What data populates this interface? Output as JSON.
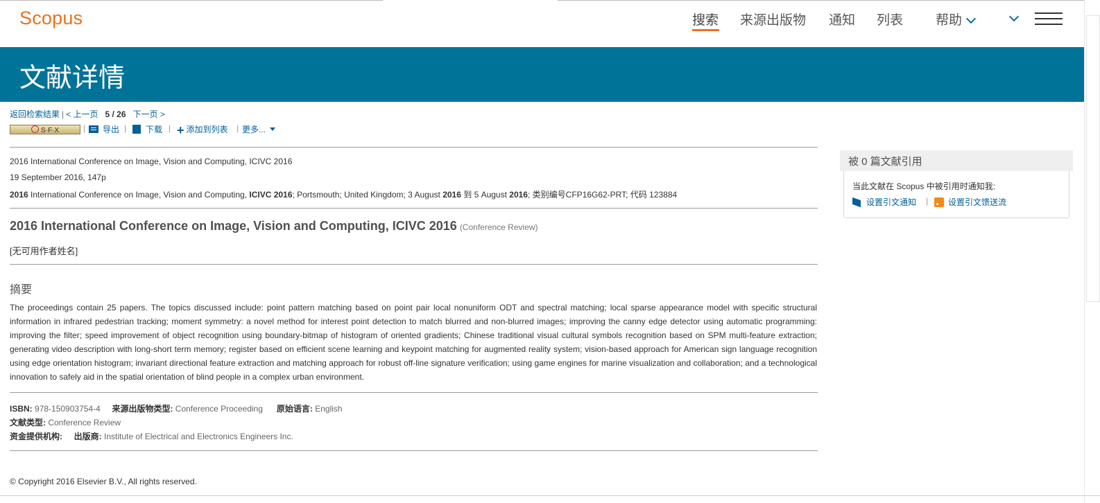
{
  "header": {
    "logo": "Scopus",
    "nav": {
      "search": "搜索",
      "sources": "来源出版物",
      "alerts": "通知",
      "lists": "列表",
      "help": "帮助"
    }
  },
  "banner": {
    "title": "文献详情"
  },
  "pagenav": {
    "back": "返回检索结果",
    "prev": "< 上一页",
    "position": "5 / 26",
    "next": "下一页 >"
  },
  "toolbar": {
    "sfx": "S·F·X",
    "export": "导出",
    "download": "下载",
    "add_to_list": "添加到列表",
    "more": "更多..."
  },
  "source": {
    "name": "2016 International Conference on Image, Vision and Computing, ICIVC 2016",
    "date_pages": "19 September 2016, 147p",
    "conf_year": "2016",
    "conf_name": " International Conference on Image, Vision and Computing, ",
    "conf_acronym": "ICIVC 2016",
    "conf_location": "; Portsmouth; United Kingdom; 3 August ",
    "conf_start_year": "2016",
    "conf_to": " 到 5 August ",
    "conf_end_year": "2016",
    "conf_codes": "; 类别编号CFP16G62-PRT; 代码 123884"
  },
  "document": {
    "title": "2016 International Conference on Image, Vision and Computing, ICIVC 2016",
    "type": "(Conference Review)",
    "authors": "[无可用作者姓名]"
  },
  "abstract": {
    "heading": "摘要",
    "text": "The proceedings contain 25 papers. The topics discussed include: point pattern matching based on point pair local nonuniform ODT and spectral matching; local sparse appearance model with specific structural information in infrared pedestrian tracking; moment symmetry: a novel method for interest point detection to match blurred and non-blurred images; improving the canny edge detector using automatic programming: improving the filter; speed improvement of object recognition using boundary-bitmap of histogram of oriented gradients; Chinese traditional visual cultural symbols recognition based on SPM multi-feature extraction; generating video description with long-short term memory; register based on efficient scene learning and keypoint matching for augmented reality system; vision-based approach for American sign language recognition using edge orientation histogram; invariant directional feature extraction and matching approach for robust off-line signature verification; using game engines for marine visualization and collaboration; and a technological innovation to safely aid in the spatial orientation of blind people in a complex urban environment."
  },
  "metadata": {
    "isbn_label": "ISBN:",
    "isbn": "978-150903754-4",
    "source_type_label": "来源出版物类型:",
    "source_type": "Conference Proceeding",
    "language_label": "原始语言:",
    "language": "English",
    "doc_type_label": "文献类型:",
    "doc_type": "Conference Review",
    "funding_label": "资金提供机构:",
    "publisher_label": "出版商:",
    "publisher": "Institute of Electrical and Electronics Engineers Inc."
  },
  "footer": {
    "copyright": "© Copyright 2016 Elsevier B.V., All rights reserved."
  },
  "sidebar": {
    "cited_by": "被 0 篇文献引用",
    "notify_text": "当此文献在 Scopus 中被引用时通知我:",
    "set_alert": "设置引文通知",
    "set_feed": "设置引文馈送流"
  },
  "colors": {
    "brand": "#e9711c",
    "banner": "#007398",
    "link": "#00609b"
  }
}
